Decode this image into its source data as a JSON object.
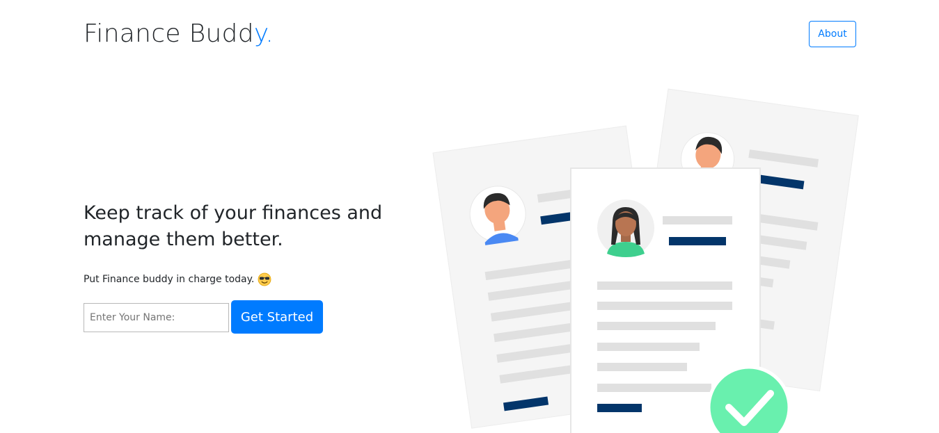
{
  "header": {
    "brand_main": "Finance Budd",
    "brand_accent": "y.",
    "about_label": "About"
  },
  "hero": {
    "headline": "Keep track of your finances and manage them better.",
    "subline": "Put Finance buddy in charge today.",
    "subline_icon": "sunglasses-emoji-icon"
  },
  "form": {
    "name_placeholder": "Enter Your Name:",
    "name_value": "",
    "start_label": "Get Started"
  },
  "colors": {
    "accent": "#007bff",
    "navy": "#03356a",
    "check_green": "#69f0ae",
    "line_gray": "#e0e0e0",
    "paper_gray": "#f5f5f5"
  },
  "illustration": {
    "icon": "resumes-documents-icon"
  }
}
